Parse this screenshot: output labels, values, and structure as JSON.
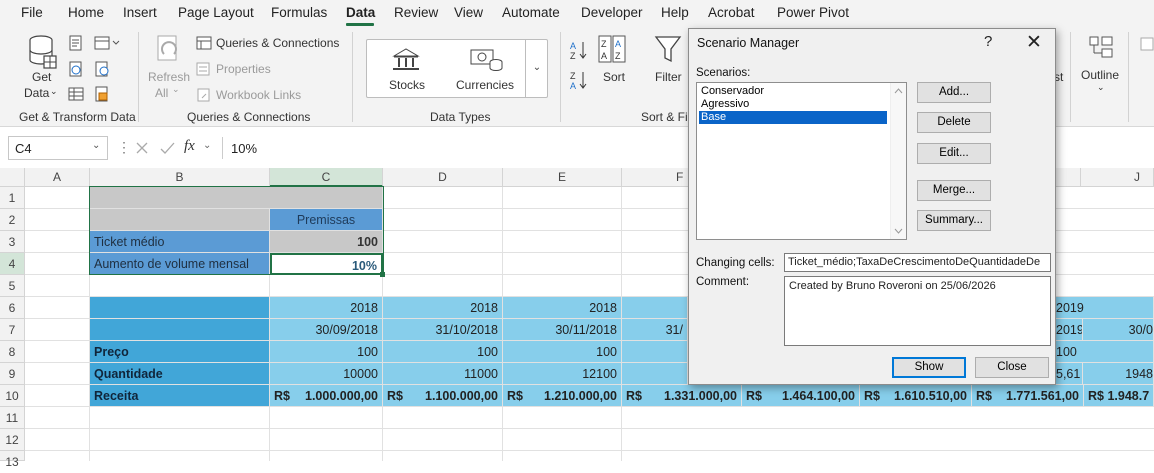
{
  "menu": {
    "items": [
      "File",
      "Home",
      "Insert",
      "Page Layout",
      "Formulas",
      "Data",
      "Review",
      "View",
      "Automate",
      "Developer",
      "Help",
      "Acrobat",
      "Power Pivot"
    ],
    "active": "Data"
  },
  "ribbon": {
    "get_data_line1": "Get",
    "get_data_line2": "Data",
    "refresh_line1": "Refresh",
    "refresh_line2": "All",
    "queries_connections": "Queries & Connections",
    "properties": "Properties",
    "workbook_links": "Workbook Links",
    "stocks": "Stocks",
    "currencies": "Currencies",
    "sort": "Sort",
    "filter": "Filter",
    "outline": "Outline",
    "advanced_partial": "st",
    "groups": {
      "get_transform": "Get & Transform Data",
      "queries_connections": "Queries & Connections",
      "data_types": "Data Types",
      "sort_filter": "Sort & Fi"
    }
  },
  "formula_bar": {
    "name_box": "C4",
    "fx": "fx",
    "value": "10%"
  },
  "sheet": {
    "columns": [
      "A",
      "B",
      "C",
      "D",
      "E",
      "F",
      "G",
      "H",
      "I",
      "J"
    ],
    "rows": [
      "1",
      "2",
      "3",
      "4",
      "5",
      "6",
      "7",
      "8",
      "9",
      "10",
      "11",
      "12",
      "13"
    ],
    "premissas_header": "Premissas",
    "ticket_label": "Ticket médio",
    "ticket_value": "100",
    "aumento_label": "Aumento de volume mensal",
    "aumento_value": "10%",
    "years": [
      "2018",
      "2018",
      "2018",
      "2019"
    ],
    "dates": [
      "30/09/2018",
      "31/10/2018",
      "30/11/2018",
      "31/",
      "2019",
      "30/0"
    ],
    "preco_label": "Preço",
    "preco_values": [
      "100",
      "100",
      "100",
      "100"
    ],
    "quantidade_label": "Quantidade",
    "quantidade_values": [
      "10000",
      "11000",
      "12100",
      "5,61",
      "1948"
    ],
    "receita_label": "Receita",
    "receita_prefix": "R$",
    "receita_values": [
      "1.000.000,00",
      "1.100.000,00",
      "1.210.000,00",
      "1.331.000,00",
      "1.464.100,00",
      "1.610.510,00",
      "1.771.561,00",
      "1.948.7"
    ]
  },
  "dialog": {
    "title": "Scenario Manager",
    "help": "?",
    "close_glyph": "✕",
    "scenarios_label": "Scenarios:",
    "scenarios": [
      "Conservador",
      "Agressivo",
      "Base"
    ],
    "selected": "Base",
    "buttons": {
      "add": "Add...",
      "delete": "Delete",
      "edit": "Edit...",
      "merge": "Merge...",
      "summary": "Summary...",
      "show": "Show",
      "close": "Close"
    },
    "changing_cells_label": "Changing cells:",
    "changing_cells_value": "Ticket_médio;TaxaDeCrescimentoDeQuantidadeDe",
    "comment_label": "Comment:",
    "comment_value": "Created by Bruno Roveroni on 25/06/2026"
  },
  "colors": {
    "excel_green": "#217346",
    "header_blue": "#5b9bd5",
    "table_blue": "#87ceeb",
    "label_blue": "#41a6d8",
    "gray_fill": "#c8c8c8",
    "selection_blue": "#0a64c8"
  }
}
